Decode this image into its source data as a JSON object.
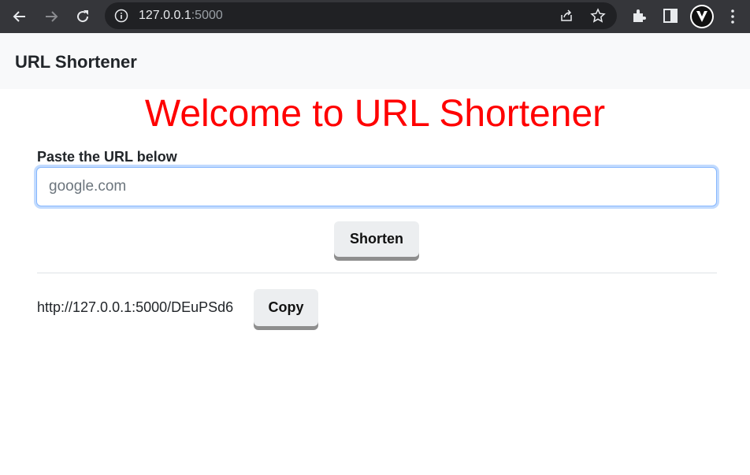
{
  "browser": {
    "address_host": "127.0.0.1",
    "address_port": ":5000",
    "icons": [
      "back-icon",
      "forward-icon",
      "reload-icon",
      "info-icon",
      "share-icon",
      "star-icon",
      "extensions-icon",
      "side-panel-icon",
      "profile-icon",
      "menu-icon"
    ]
  },
  "navbar": {
    "brand": "URL Shortener"
  },
  "main": {
    "heading": "Welcome to URL Shortener",
    "heading_color": "#ff0000",
    "input_label": "Paste the URL below",
    "input_placeholder": "google.com",
    "shorten_label": "Shorten",
    "short_url": "http://127.0.0.1:5000/DEuPSd6",
    "copy_label": "Copy"
  }
}
